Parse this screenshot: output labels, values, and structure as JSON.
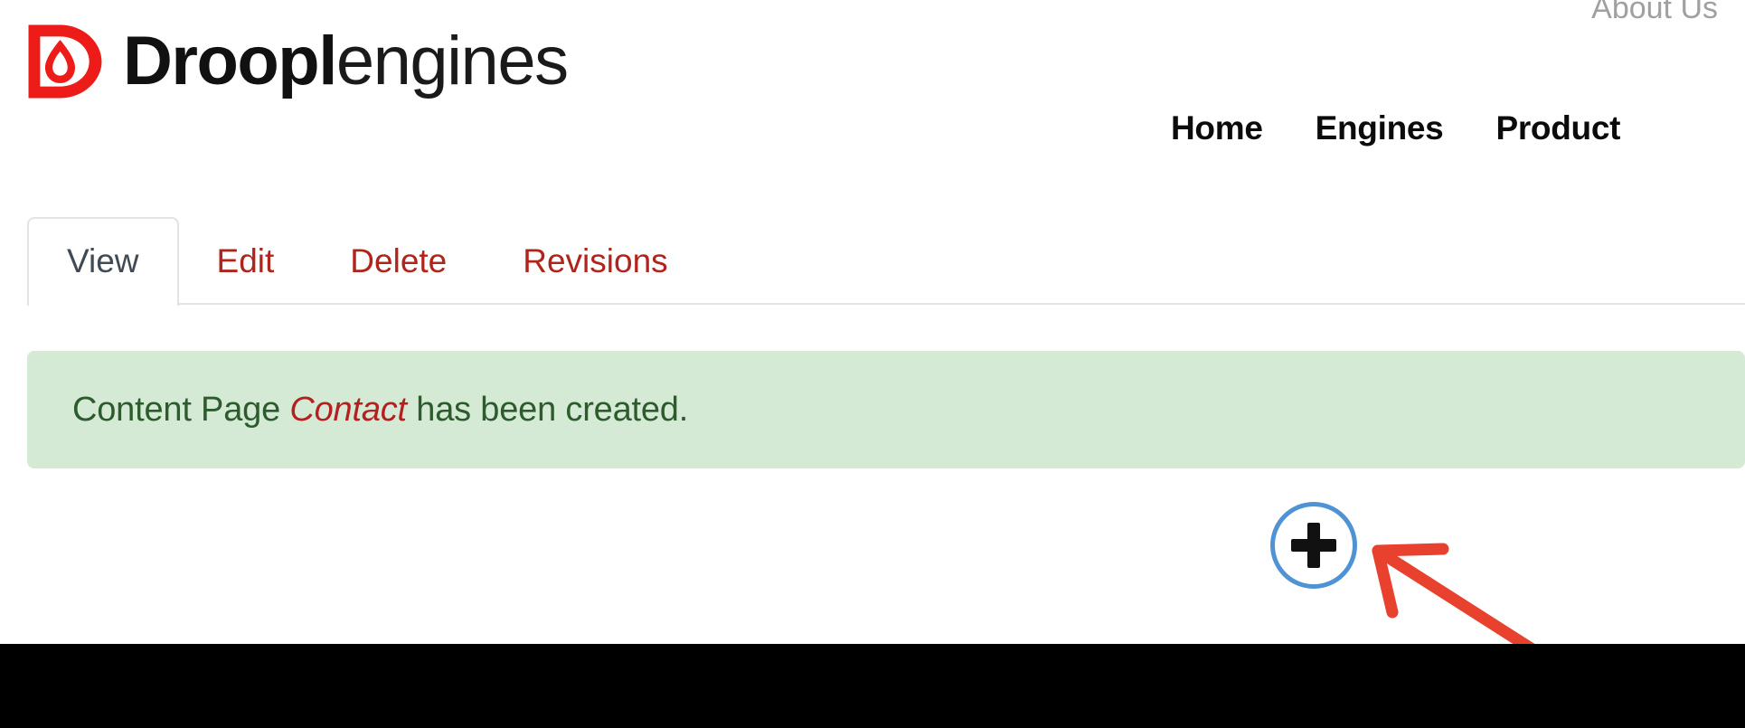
{
  "colors": {
    "brand_red": "#ee1c19",
    "tab_link_red": "#b0241c",
    "tab_active_text": "#3f4a55",
    "message_bg": "#d5ead5",
    "message_text": "#2d5b2d",
    "message_entity": "#b32020",
    "add_button_border": "#4f93d4",
    "annotation_arrow": "#e8412e",
    "footer_bg": "#000000",
    "utility_link": "#a0a0a0",
    "nav_link": "#0b0b0b"
  },
  "header": {
    "logo": {
      "icon": "droplet-d-logo-icon",
      "word_bold": "Droopl",
      "word_light": "engines"
    },
    "utility_nav": [
      {
        "label": "About Us"
      }
    ],
    "main_nav": [
      {
        "label": "Home"
      },
      {
        "label": "Engines"
      },
      {
        "label": "Product"
      }
    ]
  },
  "tabs": [
    {
      "label": "View",
      "active": true
    },
    {
      "label": "Edit",
      "active": false
    },
    {
      "label": "Delete",
      "active": false
    },
    {
      "label": "Revisions",
      "active": false
    }
  ],
  "messages": {
    "status": {
      "prefix": "Content Page ",
      "entity": "Contact",
      "suffix": " has been created."
    }
  },
  "add_control": {
    "name": "add-content-button",
    "icon": "plus-icon"
  },
  "annotation": {
    "type": "arrow",
    "points_to": "add-content-button",
    "direction": "up-left"
  }
}
